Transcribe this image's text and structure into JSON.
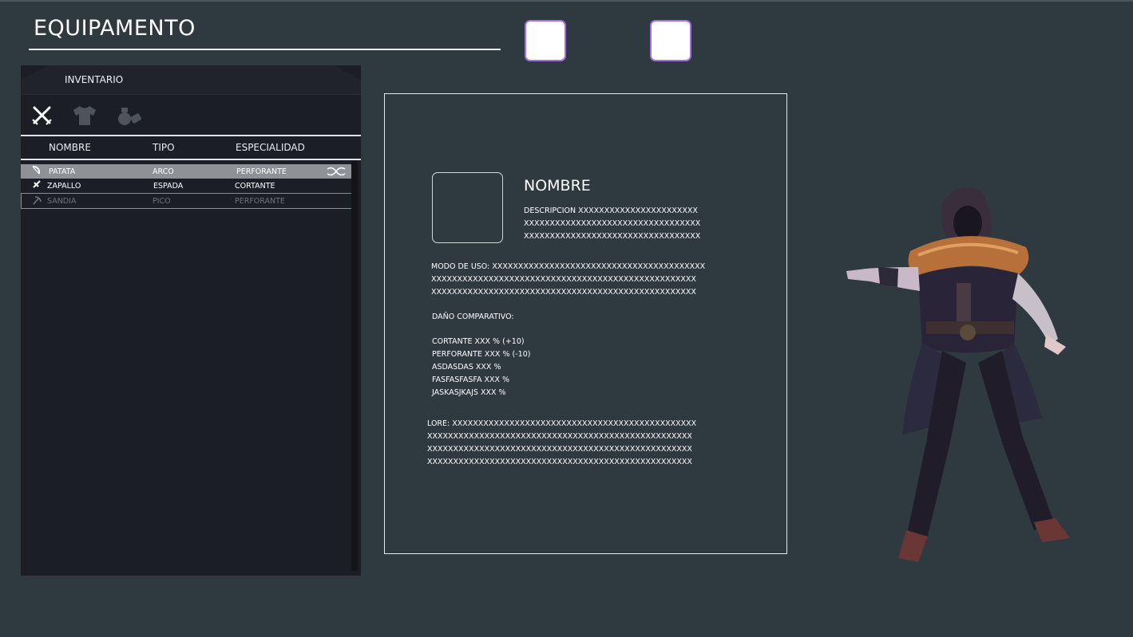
{
  "header": {
    "title": "EQUIPAMENTO"
  },
  "inventory": {
    "title": "INVENTARIO",
    "columns": [
      "NOMBRE",
      "TIPO",
      "ESPECIALIDAD"
    ],
    "rows": [
      {
        "name": "PATATA",
        "type": "ARCO",
        "special": "PERFORANTE"
      },
      {
        "name": "ZAPALLO",
        "type": "ESPADA",
        "special": "CORTANTE"
      },
      {
        "name": "SANDIA",
        "type": "PICO",
        "special": "PERFORANTE"
      }
    ]
  },
  "detail": {
    "name": "NOMBRE",
    "description": "DESCRIPCION XXXXXXXXXXXXXXXXXXXXXXX\nXXXXXXXXXXXXXXXXXXXXXXXXXXXXXXXXXX\nXXXXXXXXXXXXXXXXXXXXXXXXXXXXXXXXXX",
    "usage": "MODO DE USO: XXXXXXXXXXXXXXXXXXXXXXXXXXXXXXXXXXXXXXXXX\nXXXXXXXXXXXXXXXXXXXXXXXXXXXXXXXXXXXXXXXXXXXXXXXXXXX\nXXXXXXXXXXXXXXXXXXXXXXXXXXXXXXXXXXXXXXXXXXXXXXXXXXX",
    "damage_title": "DAÑO COMPARATIVO:",
    "damage": "CORTANTE XXX % (+10)\nPERFORANTE XXX % (-10)\nASDASDAS XXX %\nFASFASFASFA XXX %\nJASKASJKAJS XXX %",
    "lore": "LORE: XXXXXXXXXXXXXXXXXXXXXXXXXXXXXXXXXXXXXXXXXXXXXXX\nXXXXXXXXXXXXXXXXXXXXXXXXXXXXXXXXXXXXXXXXXXXXXXXXXXX\nXXXXXXXXXXXXXXXXXXXXXXXXXXXXXXXXXXXXXXXXXXXXXXXXXXX\nXXXXXXXXXXXXXXXXXXXXXXXXXXXXXXXXXXXXXXXXXXXXXXXXXXX"
  },
  "icons": {
    "tabs": [
      "crossed-swords-icon",
      "shirt-icon",
      "bag-icon"
    ],
    "rows": [
      "bow-icon",
      "sword-icon",
      "pickaxe-icon"
    ],
    "selected_action": "swap-icon"
  },
  "colors": {
    "background": "#2f3940",
    "panel": "#1b1e24",
    "slot_border": "#a66ee0",
    "selected_row": "#8e9296"
  }
}
